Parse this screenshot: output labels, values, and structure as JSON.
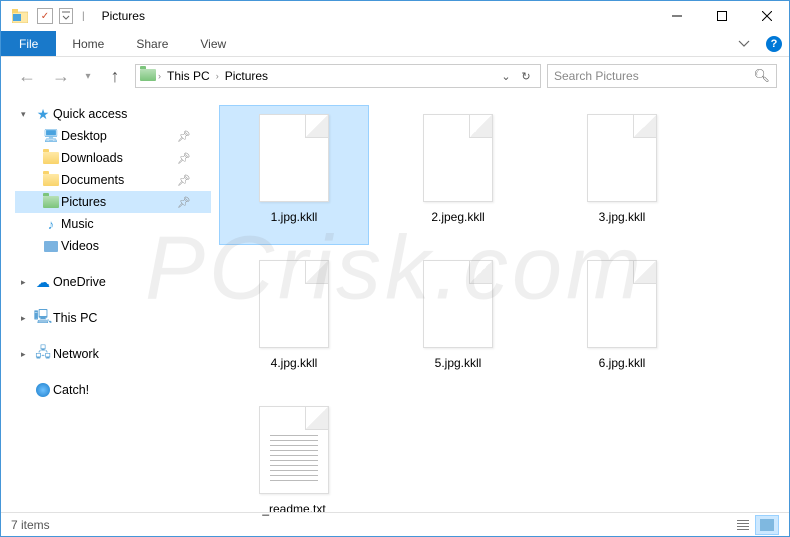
{
  "titlebar": {
    "title": "Pictures"
  },
  "ribbon": {
    "file": "File",
    "tabs": [
      "Home",
      "Share",
      "View"
    ]
  },
  "breadcrumb": [
    "This PC",
    "Pictures"
  ],
  "search": {
    "placeholder": "Search Pictures"
  },
  "sidebar": {
    "quick_access": {
      "label": "Quick access",
      "items": [
        {
          "label": "Desktop",
          "pinned": true,
          "icon": "desktop"
        },
        {
          "label": "Downloads",
          "pinned": true,
          "icon": "folder"
        },
        {
          "label": "Documents",
          "pinned": true,
          "icon": "folder"
        },
        {
          "label": "Pictures",
          "pinned": true,
          "icon": "pictures",
          "selected": true
        },
        {
          "label": "Music",
          "pinned": false,
          "icon": "music"
        },
        {
          "label": "Videos",
          "pinned": false,
          "icon": "video"
        }
      ]
    },
    "onedrive": "OneDrive",
    "this_pc": "This PC",
    "network": "Network",
    "catch": "Catch!"
  },
  "files": [
    {
      "name": "1.jpg.kkll",
      "type": "blank",
      "selected": true
    },
    {
      "name": "2.jpeg.kkll",
      "type": "blank"
    },
    {
      "name": "3.jpg.kkll",
      "type": "blank"
    },
    {
      "name": "4.jpg.kkll",
      "type": "blank"
    },
    {
      "name": "5.jpg.kkll",
      "type": "blank"
    },
    {
      "name": "6.jpg.kkll",
      "type": "blank"
    },
    {
      "name": "_readme.txt",
      "type": "text"
    }
  ],
  "statusbar": {
    "count": "7 items"
  },
  "watermark": "PCrisk.com"
}
